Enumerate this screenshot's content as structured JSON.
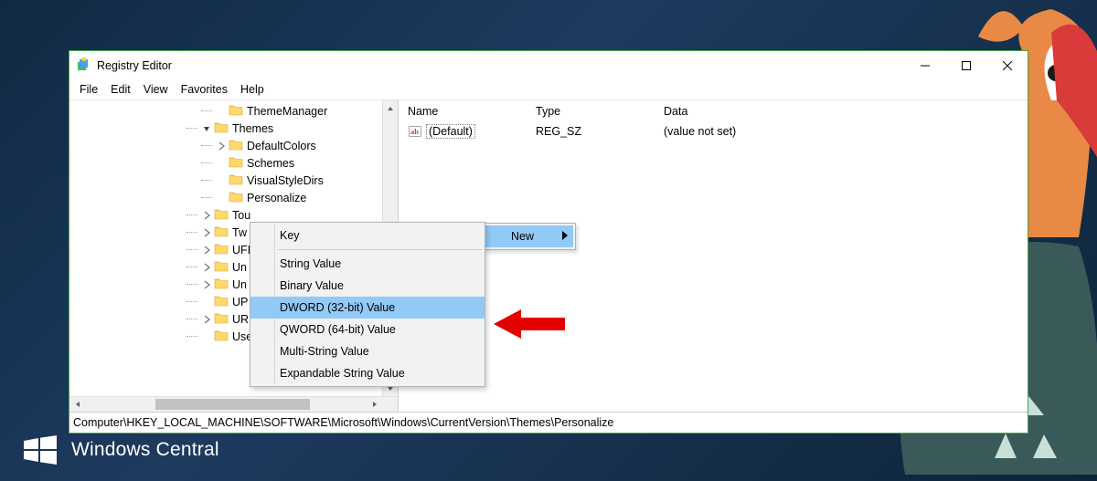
{
  "window": {
    "title": "Registry Editor",
    "controls": {
      "minimize": "minimize",
      "maximize": "maximize",
      "close": "close"
    }
  },
  "menubar": [
    "File",
    "Edit",
    "View",
    "Favorites",
    "Help"
  ],
  "tree": {
    "nodes": [
      {
        "label": "ThemeManager",
        "depth": 9,
        "twist": "none"
      },
      {
        "label": "Themes",
        "depth": 8,
        "twist": "expanded"
      },
      {
        "label": "DefaultColors",
        "depth": 9,
        "twist": "collapsed"
      },
      {
        "label": "Schemes",
        "depth": 9,
        "twist": "none"
      },
      {
        "label": "VisualStyleDirs",
        "depth": 9,
        "twist": "none"
      },
      {
        "label": "Personalize",
        "depth": 9,
        "twist": "none"
      },
      {
        "label": "Tou",
        "depth": 8,
        "twist": "collapsed",
        "cut": true
      },
      {
        "label": "Tw",
        "depth": 8,
        "twist": "collapsed",
        "cut": true
      },
      {
        "label": "UFI",
        "depth": 8,
        "twist": "collapsed",
        "cut": true
      },
      {
        "label": "Un",
        "depth": 8,
        "twist": "collapsed",
        "cut": true
      },
      {
        "label": "Un",
        "depth": 8,
        "twist": "collapsed",
        "cut": true
      },
      {
        "label": "UP",
        "depth": 8,
        "twist": "none",
        "cut": true
      },
      {
        "label": "UR",
        "depth": 8,
        "twist": "collapsed",
        "cut": true
      },
      {
        "label": "Use",
        "depth": 8,
        "twist": "none",
        "cut": true
      }
    ]
  },
  "list": {
    "columns": {
      "name": "Name",
      "type": "Type",
      "data": "Data"
    },
    "rows": [
      {
        "name": "(Default)",
        "type": "REG_SZ",
        "data": "(value not set)"
      }
    ]
  },
  "context_parent": {
    "label": "New"
  },
  "context_menu": {
    "items": [
      {
        "label": "Key",
        "highlight": false
      },
      {
        "sep": true
      },
      {
        "label": "String Value",
        "highlight": false
      },
      {
        "label": "Binary Value",
        "highlight": false
      },
      {
        "label": "DWORD (32-bit) Value",
        "highlight": true
      },
      {
        "label": "QWORD (64-bit) Value",
        "highlight": false
      },
      {
        "label": "Multi-String Value",
        "highlight": false
      },
      {
        "label": "Expandable String Value",
        "highlight": false
      }
    ]
  },
  "statusbar": {
    "path": "Computer\\HKEY_LOCAL_MACHINE\\SOFTWARE\\Microsoft\\Windows\\CurrentVersion\\Themes\\Personalize"
  },
  "branding": {
    "text": "Windows Central"
  }
}
